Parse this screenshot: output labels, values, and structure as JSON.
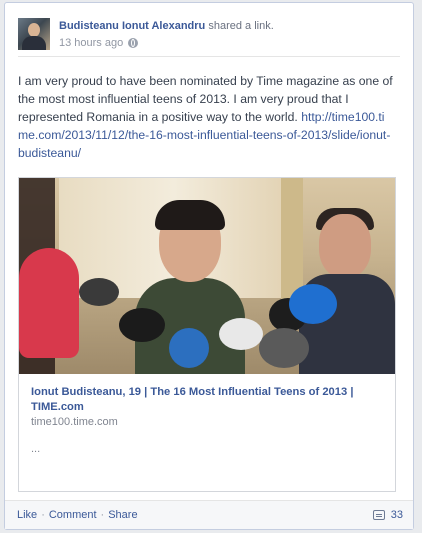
{
  "post": {
    "author": "Budisteanu Ionut Alexandru",
    "action": "shared a link.",
    "timestamp": "13 hours ago",
    "privacy_icon": "globe-icon",
    "text": "I am very proud to have been nominated by Time magazine as one of the most most influential teens of 2013. I am very proud that I represented Romania in a positive way to the world.",
    "link": "http://time100.time.com/2013/11/12/the-16-most-influential-teens-of-2013/slide/ionut-budisteanu/"
  },
  "link_preview": {
    "title": "Ionut Budisteanu, 19 | The 16 Most Influential Teens of 2013 | TIME.com",
    "domain": "time100.time.com",
    "description": "..."
  },
  "footer": {
    "like": "Like",
    "comment": "Comment",
    "share": "Share",
    "separator": "·",
    "comment_count": "33",
    "comment_icon": "comment-icon"
  },
  "colors": {
    "link_blue": "#3b5998",
    "meta_gray": "#9197a3",
    "footer_bg": "#f6f7f9"
  }
}
